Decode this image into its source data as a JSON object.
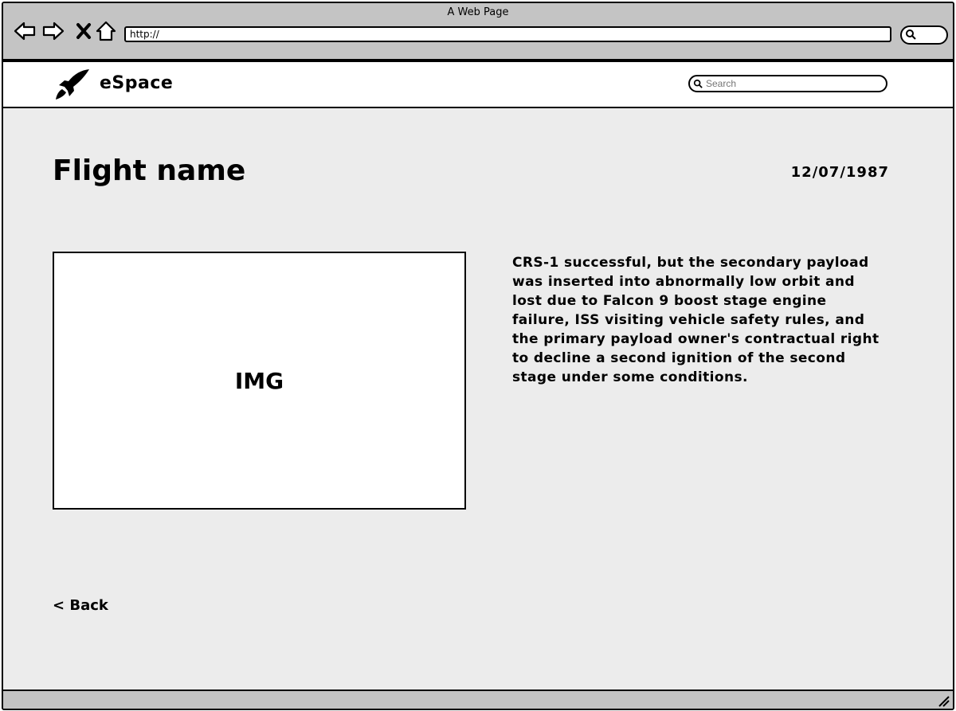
{
  "window": {
    "title": "A Web Page"
  },
  "browser": {
    "address": "http://",
    "icons": {
      "back": "back-arrow-icon",
      "forward": "forward-arrow-icon",
      "stop": "close-icon",
      "home": "home-icon",
      "search": "search-icon"
    }
  },
  "header": {
    "logo_icon": "rocket-icon",
    "brand": "eSpace",
    "search_placeholder": "Search"
  },
  "flight": {
    "title": "Flight name",
    "date": "12/07/1987",
    "image_placeholder": "IMG",
    "description": "CRS-1 successful, but the secondary payload was inserted into abnormally low orbit and lost due to Falcon 9 boost stage engine failure, ISS visiting vehicle safety rules, and the primary payload owner's contractual right to decline a second ignition of the second stage under some conditions."
  },
  "nav": {
    "back_label": "< Back"
  }
}
